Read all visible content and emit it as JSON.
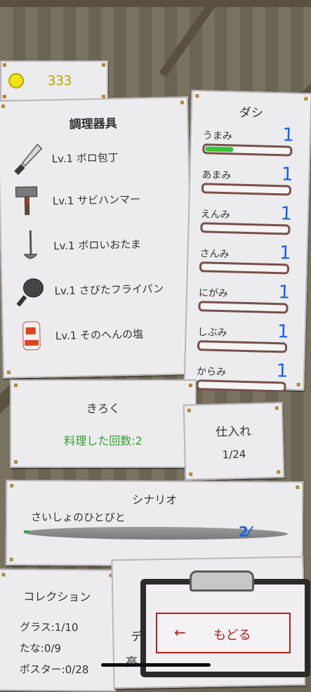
{
  "currency": {
    "amount": "333",
    "icon": "coin-icon"
  },
  "tools": {
    "title": "調理器具",
    "items": [
      {
        "name": "Lv.1 ボロ包丁",
        "icon": "knife-icon"
      },
      {
        "name": "Lv.1 サビハンマー",
        "icon": "hammer-icon"
      },
      {
        "name": "Lv.1 ボロいおたま",
        "icon": "ladle-icon"
      },
      {
        "name": "Lv.1 さびたフライパン",
        "icon": "frying-pan-icon"
      },
      {
        "name": "Lv.1 そのへんの塩",
        "icon": "salt-icon"
      }
    ]
  },
  "flavor": {
    "title": "ダシ",
    "items": [
      {
        "label": "うまみ",
        "value": "1",
        "fill": 0.33
      },
      {
        "label": "あまみ",
        "value": "1",
        "fill": 0
      },
      {
        "label": "えんみ",
        "value": "1",
        "fill": 0
      },
      {
        "label": "さんみ",
        "value": "1",
        "fill": 0
      },
      {
        "label": "にがみ",
        "value": "1",
        "fill": 0
      },
      {
        "label": "しぶみ",
        "value": "1",
        "fill": 0
      },
      {
        "label": "からみ",
        "value": "1",
        "fill": 0
      }
    ],
    "colors": {
      "value": "#1a62e6",
      "bar_fill": "#3ac43a",
      "bar_border": "#7a4f4a"
    }
  },
  "record": {
    "title": "きろく",
    "value": "料理した回数:2"
  },
  "stock": {
    "title": "仕入れ",
    "value": "1/24"
  },
  "scenario": {
    "title": "シナリオ",
    "subtitle": "さいしょのひとびと",
    "progress": 0.02
  },
  "collection": {
    "title": "コレクション",
    "items": [
      "グラス:1/10",
      "たな:0/9",
      "ポスター:0/28"
    ]
  },
  "misc": {
    "line1": "デ",
    "line2": "高"
  },
  "back_button": {
    "arrow": "←",
    "label": "もどる"
  }
}
